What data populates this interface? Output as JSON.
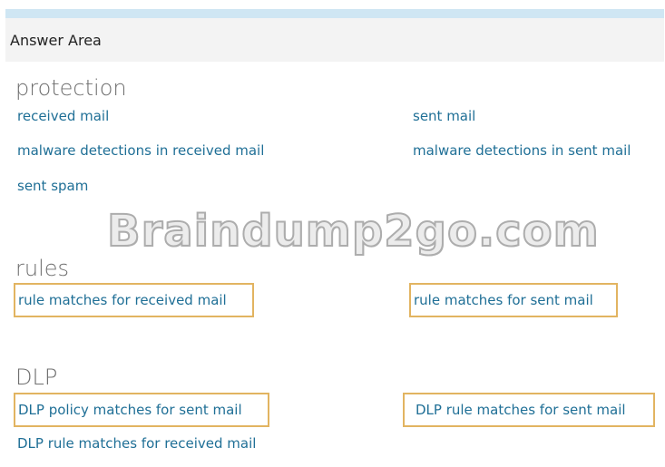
{
  "header": {
    "title": "Answer Area"
  },
  "watermark": "Braindump2go.com",
  "sections": {
    "protection": {
      "title": "protection",
      "items": {
        "received_mail": "received mail",
        "sent_mail": "sent mail",
        "malware_received": "malware detections in received mail",
        "malware_sent": "malware detections in sent mail",
        "sent_spam": "sent spam"
      }
    },
    "rules": {
      "title": "rules",
      "items": {
        "rule_received": "rule matches for received mail",
        "rule_sent": "rule matches for sent mail"
      }
    },
    "dlp": {
      "title": "DLP",
      "items": {
        "policy_sent": "DLP policy matches for sent mail",
        "rule_sent": "DLP rule matches for sent mail",
        "rule_received": "DLP rule matches for received mail"
      }
    }
  },
  "colors": {
    "link": "#1f6f96",
    "highlight_border": "#e2b461",
    "header_bg": "#f3f3f3",
    "top_strip": "#cfe6f3"
  }
}
